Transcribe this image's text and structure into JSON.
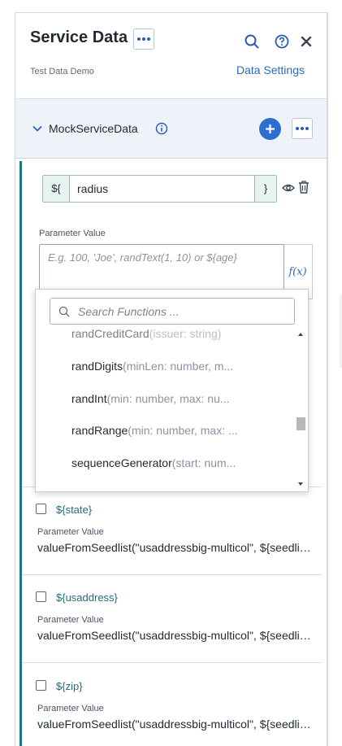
{
  "header": {
    "title": "Service Data",
    "subtitle": "Test Data Demo",
    "settings_link": "Data Settings"
  },
  "section": {
    "title": "MockServiceData"
  },
  "parameter": {
    "prefix": "${",
    "name": "radius",
    "suffix": "}",
    "value_label": "Parameter Value",
    "value_placeholder": "E.g. 100, 'Joe', randText(1, 10) or ${age}",
    "fx_label": "f(x)"
  },
  "function_dropdown": {
    "search_placeholder": "Search Functions ...",
    "items": [
      {
        "name": "randCreditCard",
        "signature": "(issuer: string)"
      },
      {
        "name": "randDigits",
        "signature": "(minLen: number, m..."
      },
      {
        "name": "randInt",
        "signature": "(min: number, max: nu..."
      },
      {
        "name": "randRange",
        "signature": "(min: number, max: ..."
      },
      {
        "name": "sequenceGenerator",
        "signature": "(start: num..."
      }
    ]
  },
  "rows": [
    {
      "name": "${state}",
      "label": "Parameter Value",
      "value": "valueFromSeedlist(\"usaddressbig-multicol\", ${seedlistIndex})"
    },
    {
      "name": "${usaddress}",
      "label": "Parameter Value",
      "value": "valueFromSeedlist(\"usaddressbig-multicol\", ${seedlistIndex})"
    },
    {
      "name": "${zip}",
      "label": "Parameter Value",
      "value": "valueFromSeedlist(\"usaddressbig-multicol\", ${seedlistIndex})"
    }
  ],
  "colors": {
    "accent": "#2d6fd0",
    "teal": "#1a7a7e",
    "link": "#2a6cb8"
  }
}
